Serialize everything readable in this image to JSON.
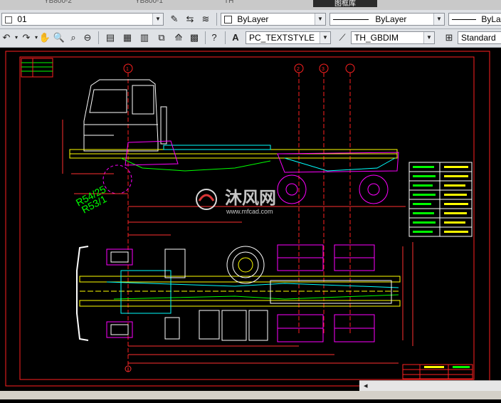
{
  "tabs": [
    "YB800-2",
    "YB800-1",
    "TH",
    "图框库"
  ],
  "toolbar1": {
    "layer_value": "01",
    "color_value": "ByLayer",
    "linetype_value": "ByLayer",
    "lineweight_value": "ByLay"
  },
  "toolbar2": {
    "text_style_value": "PC_TEXTSTYLE",
    "dim_style_value": "TH_GBDIM",
    "table_style_value": "Standard"
  },
  "drawing": {
    "dim_r1": "R54/25",
    "dim_r2": "R53/1",
    "watermark_cn": "沐风网",
    "watermark_url": "www.mfcad.com",
    "axis_labels": [
      "1",
      "2",
      "3"
    ]
  },
  "colors": {
    "frame": "#ff2020",
    "chassis": "#ffff00",
    "cab": "#ffffff",
    "wheels": "#ff00ff",
    "dims": "#ff3030",
    "green": "#00ff00",
    "cyan": "#00ffff"
  }
}
